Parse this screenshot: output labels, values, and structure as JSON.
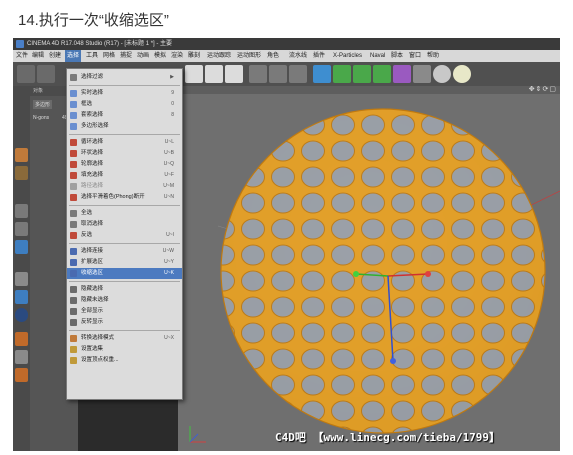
{
  "step_title": "14.执行一次“收缩选区”",
  "window": {
    "title": "CINEMA 4D R17.048 Studio (R17) - [未标题 1 *] - 主要"
  },
  "menubar": {
    "items": [
      "文件",
      "编辑",
      "创建",
      "选择",
      "工具",
      "网格",
      "捕捉",
      "动画",
      "模拟",
      "渲染",
      "雕刻",
      "运动跟踪",
      "运动图形",
      "角色",
      "流水线",
      "插件",
      "X-Particles",
      "Naval",
      "脚本",
      "窗口",
      "帮助"
    ]
  },
  "objects_panel": {
    "header": "对象",
    "object_name": "多边形",
    "info_label": "N-gons",
    "info_value": "49"
  },
  "select_menu": {
    "items": [
      {
        "label": "选择过滤",
        "shortcut": "▶",
        "icon": "#7b7b7b",
        "dim": false
      },
      {
        "label": "实时选择",
        "shortcut": "9",
        "icon": "#6a8fd0",
        "dim": false
      },
      {
        "label": "框选",
        "shortcut": "0",
        "icon": "#6a8fd0",
        "dim": false
      },
      {
        "label": "套索选择",
        "shortcut": "8",
        "icon": "#6a8fd0",
        "dim": false
      },
      {
        "label": "多边形选择",
        "shortcut": "",
        "icon": "#6a8fd0",
        "dim": false
      },
      {
        "label": "循环选择",
        "shortcut": "U~L",
        "icon": "#c04a3a",
        "dim": false
      },
      {
        "label": "环状选择",
        "shortcut": "U~B",
        "icon": "#c04a3a",
        "dim": false
      },
      {
        "label": "轮廓选择",
        "shortcut": "U~Q",
        "icon": "#c04a3a",
        "dim": false
      },
      {
        "label": "填充选择",
        "shortcut": "U~F",
        "icon": "#c04a3a",
        "dim": false
      },
      {
        "label": "路径选择",
        "shortcut": "U~M",
        "icon": "#a0a0a0",
        "dim": true
      },
      {
        "label": "选择平滑着色(Phong)断开",
        "shortcut": "U~N",
        "icon": "#c04a3a",
        "dim": false
      },
      {
        "label": "全选",
        "shortcut": "",
        "icon": "#7a7a7a",
        "dim": false
      },
      {
        "label": "取消选择",
        "shortcut": "",
        "icon": "#7a7a7a",
        "dim": false
      },
      {
        "label": "反选",
        "shortcut": "U~I",
        "icon": "#c04a3a",
        "dim": false
      },
      {
        "label": "选择连接",
        "shortcut": "U~W",
        "icon": "#4a6ab0",
        "dim": false
      },
      {
        "label": "扩展选区",
        "shortcut": "U~Y",
        "icon": "#4a6ab0",
        "dim": false
      },
      {
        "label": "收缩选区",
        "shortcut": "U~K",
        "icon": "#4a6ab0",
        "dim": false
      },
      {
        "label": "隐藏选择",
        "shortcut": "",
        "icon": "#6a6a6a",
        "dim": false
      },
      {
        "label": "隐藏未选择",
        "shortcut": "",
        "icon": "#6a6a6a",
        "dim": false
      },
      {
        "label": "全部显示",
        "shortcut": "",
        "icon": "#6a6a6a",
        "dim": false
      },
      {
        "label": "反转显示",
        "shortcut": "",
        "icon": "#6a6a6a",
        "dim": false
      },
      {
        "label": "转换选择模式",
        "shortcut": "U~X",
        "icon": "#c07a3a",
        "dim": false
      },
      {
        "label": "设置选集",
        "shortcut": "",
        "icon": "#c09a3a",
        "dim": false
      },
      {
        "label": "设置顶点权重...",
        "shortcut": "",
        "icon": "#c09a3a",
        "dim": false
      }
    ],
    "highlighted_index": 16
  },
  "watermark": "C4D吧 【www.linecg.com/tieba/1799】",
  "colors": {
    "highlight": "#4c7ac0",
    "wireframe": "#e8a020",
    "viewport_bg": "#6f6f6f"
  }
}
